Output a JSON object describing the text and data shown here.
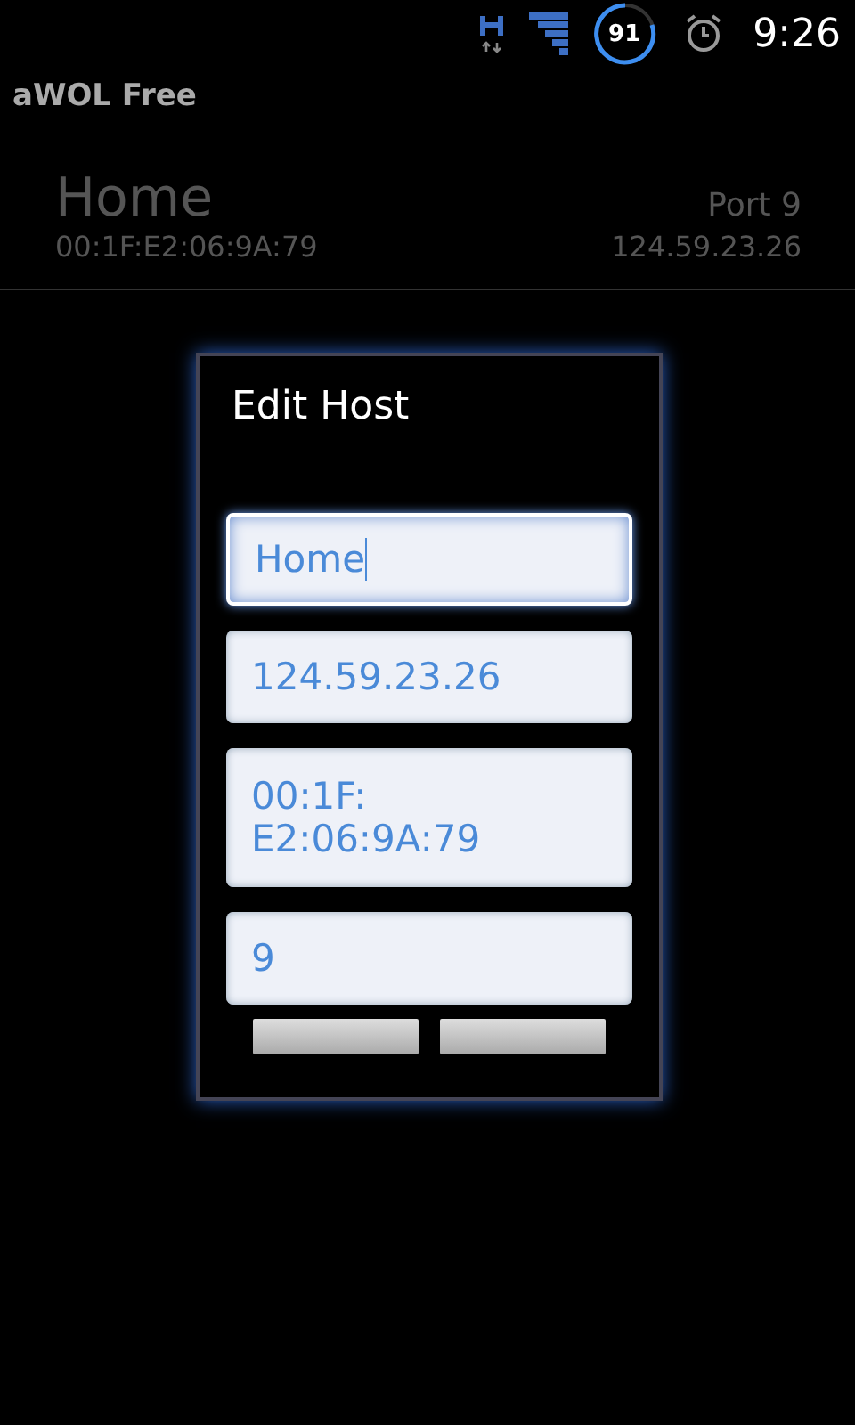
{
  "status_bar": {
    "battery": "91",
    "time": "9:26"
  },
  "app_title": "aWOL Free",
  "host": {
    "name": "Home",
    "port": "Port 9",
    "mac": "00:1F:E2:06:9A:79",
    "ip": "124.59.23.26"
  },
  "dialog": {
    "title": "Edit Host",
    "fields": [
      {
        "value": "Home",
        "focused": true
      },
      {
        "value": "124.59.23.26",
        "focused": false
      },
      {
        "value": "00:1F:",
        "value_2": "E2:06:9A:79",
        "focused": false
      },
      {
        "value": "9",
        "focused": false
      }
    ]
  }
}
